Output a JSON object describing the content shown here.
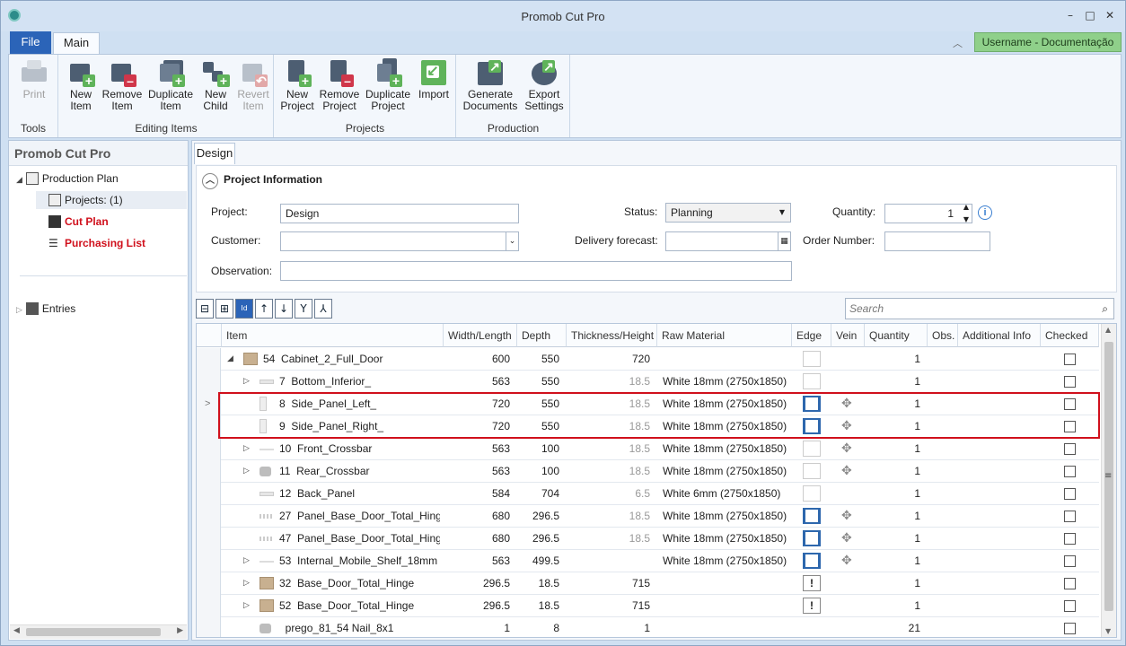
{
  "window": {
    "title": "Promob Cut Pro"
  },
  "ribbon_tabs": {
    "file": "File",
    "main": "Main"
  },
  "user": "Username - Documentação",
  "ribbon": {
    "groups": [
      {
        "label": "Tools"
      },
      {
        "label": "Editing Items"
      },
      {
        "label": "Projects"
      },
      {
        "label": "Production"
      }
    ],
    "buttons": {
      "print": [
        "Print",
        ""
      ],
      "new_item": [
        "New",
        "Item"
      ],
      "remove_item": [
        "Remove",
        "Item"
      ],
      "duplicate_item": [
        "Duplicate",
        "Item"
      ],
      "new_child": [
        "New",
        "Child"
      ],
      "revert_item": [
        "Revert",
        "Item"
      ],
      "new_project": [
        "New",
        "Project"
      ],
      "remove_project": [
        "Remove",
        "Project"
      ],
      "duplicate_project": [
        "Duplicate",
        "Project"
      ],
      "import": [
        "Import",
        ""
      ],
      "generate_documents": [
        "Generate",
        "Documents"
      ],
      "export_settings": [
        "Export",
        "Settings"
      ]
    }
  },
  "sidebar": {
    "title": "Promob Cut Pro",
    "items": [
      "Production Plan",
      "Projects: (1)",
      "Cut Plan",
      "Purchasing List",
      "Entries"
    ]
  },
  "design_tab": "Design",
  "project_info": {
    "header": "Project Information",
    "project_label": "Project:",
    "project_value": "Design",
    "status_label": "Status:",
    "status_value": "Planning",
    "quantity_label": "Quantity:",
    "quantity_value": "1",
    "customer_label": "Customer:",
    "customer_value": "",
    "delivery_label": "Delivery forecast:",
    "delivery_value": "",
    "order_label": "Order Number:",
    "order_value": "",
    "observation_label": "Observation:",
    "observation_value": ""
  },
  "search_placeholder": "Search",
  "columns": [
    "Item",
    "Width/Length",
    "Depth",
    "Thickness/Height",
    "Raw Material",
    "Edge",
    "Vein",
    "Quantity",
    "Obs.",
    "Additional Info",
    "Checked"
  ],
  "rows": [
    {
      "num": "54",
      "name": "Cabinet_2_Full_Door",
      "w": "600",
      "d": "550",
      "t": "720",
      "tgray": false,
      "mat": "",
      "edge": "plain",
      "vein": false,
      "q": "1",
      "exp": "open",
      "ico": "box",
      "level": 0
    },
    {
      "num": "7",
      "name": "Bottom_Inferior_",
      "w": "563",
      "d": "550",
      "t": "18.5",
      "tgray": true,
      "mat": "White 18mm (2750x1850)",
      "edge": "plain",
      "vein": false,
      "q": "1",
      "exp": "closed",
      "ico": "flat",
      "level": 1
    },
    {
      "num": "8",
      "name": "Side_Panel_Left_",
      "w": "720",
      "d": "550",
      "t": "18.5",
      "tgray": true,
      "mat": "White 18mm (2750x1850)",
      "edge": "blue",
      "vein": true,
      "q": "1",
      "exp": "",
      "ico": "side",
      "level": 1
    },
    {
      "num": "9",
      "name": "Side_Panel_Right_",
      "w": "720",
      "d": "550",
      "t": "18.5",
      "tgray": true,
      "mat": "White 18mm (2750x1850)",
      "edge": "blue",
      "vein": true,
      "q": "1",
      "exp": "",
      "ico": "side",
      "level": 1
    },
    {
      "num": "10",
      "name": "Front_Crossbar",
      "w": "563",
      "d": "100",
      "t": "18.5",
      "tgray": true,
      "mat": "White 18mm (2750x1850)",
      "edge": "plain",
      "vein": true,
      "q": "1",
      "exp": "closed",
      "ico": "line",
      "level": 1
    },
    {
      "num": "11",
      "name": "Rear_Crossbar",
      "w": "563",
      "d": "100",
      "t": "18.5",
      "tgray": true,
      "mat": "White 18mm (2750x1850)",
      "edge": "plain",
      "vein": true,
      "q": "1",
      "exp": "closed",
      "ico": "cam",
      "level": 1
    },
    {
      "num": "12",
      "name": "Back_Panel",
      "w": "584",
      "d": "704",
      "t": "6.5",
      "tgray": true,
      "mat": "White 6mm (2750x1850)",
      "edge": "plain",
      "vein": false,
      "q": "1",
      "exp": "",
      "ico": "flat",
      "level": 1
    },
    {
      "num": "27",
      "name": "Panel_Base_Door_Total_Hinge_",
      "w": "680",
      "d": "296.5",
      "t": "18.5",
      "tgray": true,
      "mat": "White 18mm (2750x1850)",
      "edge": "blue",
      "vein": true,
      "q": "1",
      "exp": "",
      "ico": "dots",
      "level": 1
    },
    {
      "num": "47",
      "name": "Panel_Base_Door_Total_Hinge_",
      "w": "680",
      "d": "296.5",
      "t": "18.5",
      "tgray": true,
      "mat": "White 18mm (2750x1850)",
      "edge": "blue",
      "vein": true,
      "q": "1",
      "exp": "",
      "ico": "dots",
      "level": 1
    },
    {
      "num": "53",
      "name": "Internal_Mobile_Shelf_18mm",
      "w": "563",
      "d": "499.5",
      "t": "",
      "tgray": false,
      "mat": "White 18mm (2750x1850)",
      "edge": "blue",
      "vein": true,
      "q": "1",
      "exp": "closed",
      "ico": "line",
      "level": 1
    },
    {
      "num": "32",
      "name": "Base_Door_Total_Hinge",
      "w": "296.5",
      "d": "18.5",
      "t": "715",
      "tgray": false,
      "mat": "",
      "edge": "warn",
      "vein": false,
      "q": "1",
      "exp": "closed",
      "ico": "box",
      "level": 1
    },
    {
      "num": "52",
      "name": "Base_Door_Total_Hinge",
      "w": "296.5",
      "d": "18.5",
      "t": "715",
      "tgray": false,
      "mat": "",
      "edge": "warn",
      "vein": false,
      "q": "1",
      "exp": "closed",
      "ico": "box",
      "level": 1
    },
    {
      "num": "",
      "name": "prego_81_54 Nail_8x1",
      "w": "1",
      "d": "8",
      "t": "1",
      "tgray": false,
      "mat": "",
      "edge": "",
      "vein": false,
      "q": "21",
      "exp": "",
      "ico": "cam",
      "level": 1
    }
  ],
  "colors": {
    "accent": "#2b64b8",
    "highlight": "#d0101c",
    "edge_blue": "#2d67ad",
    "ribbon_green": "#5fb35a",
    "ribbon_gray": "#4d5e72"
  }
}
